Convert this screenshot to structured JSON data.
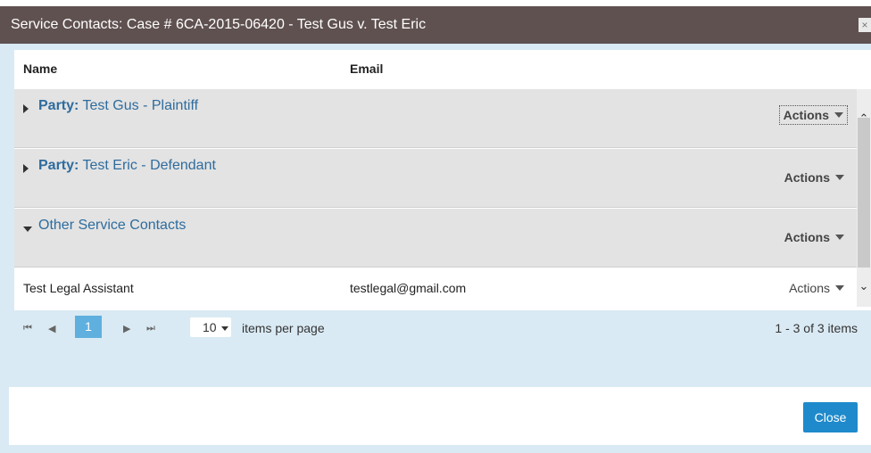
{
  "dialog": {
    "title": "Service Contacts: Case # 6CA-2015-06420 - Test Gus v. Test Eric",
    "close_icon": "×"
  },
  "table": {
    "columns": [
      "Name",
      "Email"
    ],
    "groups": [
      {
        "prefix": "Party:",
        "label": "Test Gus - Plaintiff",
        "expanded": false,
        "actions": "Actions"
      },
      {
        "prefix": "Party:",
        "label": "Test Eric - Defendant",
        "expanded": false,
        "actions": "Actions"
      },
      {
        "prefix": "",
        "label": "Other Service Contacts",
        "expanded": true,
        "actions": "Actions"
      }
    ],
    "contacts": [
      {
        "name": "Test Legal Assistant",
        "email": "testlegal@gmail.com",
        "actions": "Actions"
      }
    ]
  },
  "pager": {
    "first": "⏮",
    "prev": "◀",
    "current_page": "1",
    "next": "▶",
    "last": "⏭",
    "per_page": "10",
    "per_page_label": "items per page",
    "info": "1 - 3 of 3 items"
  },
  "footer": {
    "close_label": "Close"
  },
  "colors": {
    "titlebar": "#5f5150",
    "accent": "#1e8acb",
    "group_label": "#2e6c9e",
    "pager_bg": "#d9eaf4"
  }
}
